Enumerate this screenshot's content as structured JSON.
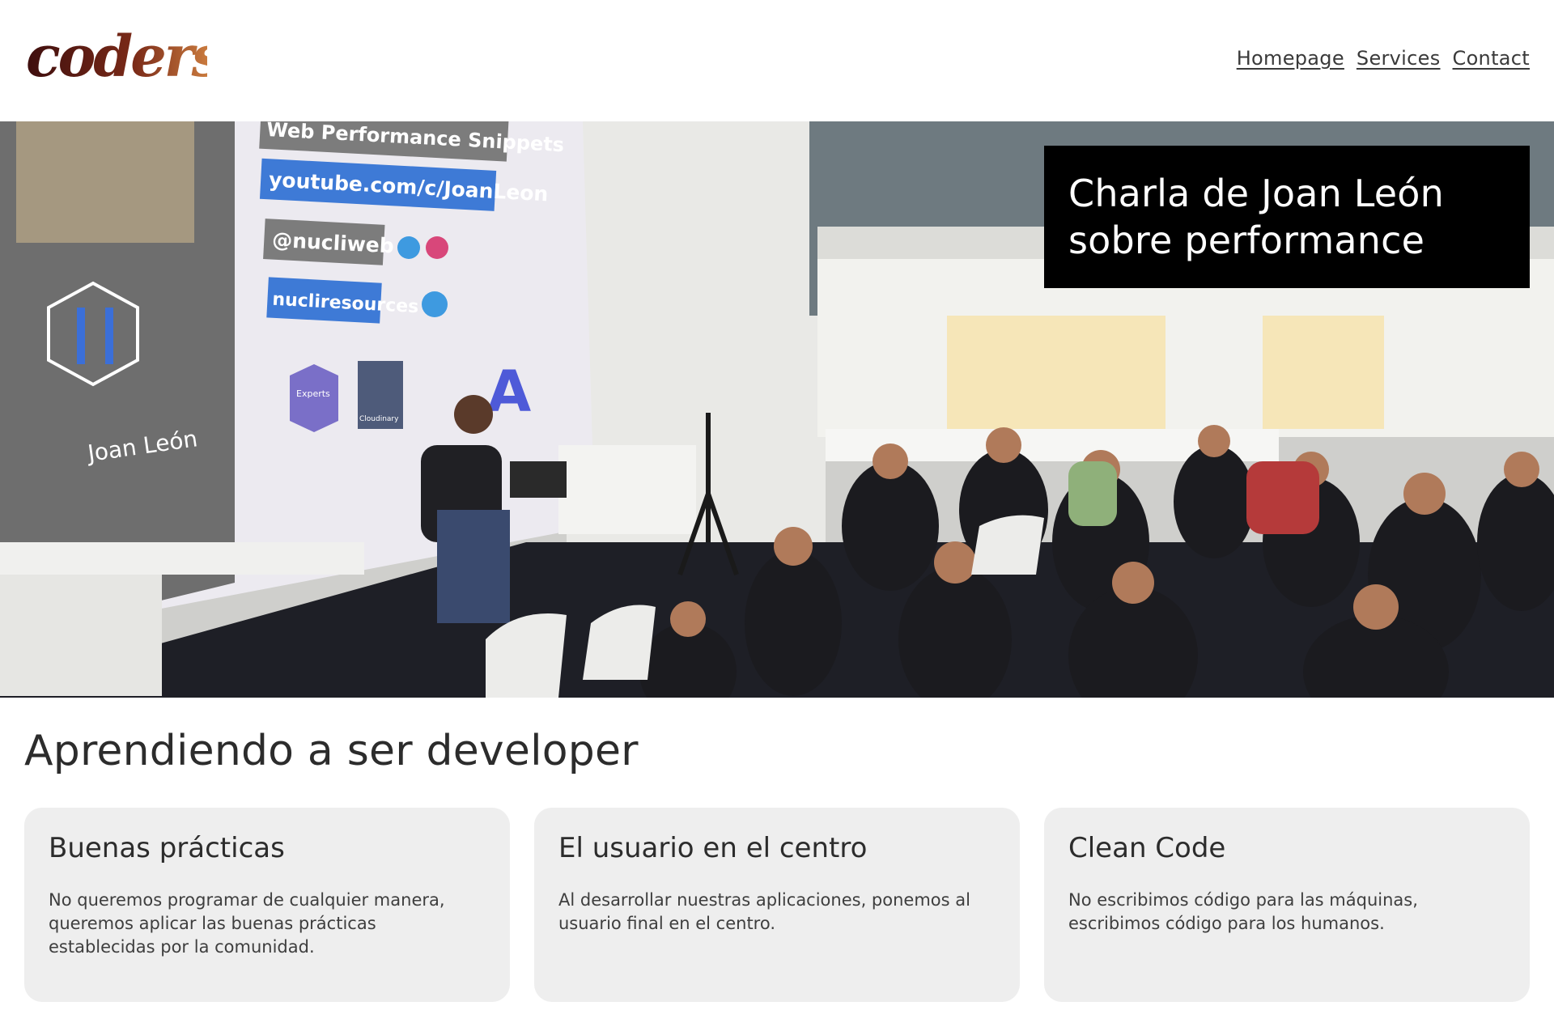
{
  "header": {
    "logo_text": "coders",
    "nav": [
      {
        "label": "Homepage"
      },
      {
        "label": "Services"
      },
      {
        "label": "Contact"
      }
    ]
  },
  "hero": {
    "caption": "Charla de Joan León sobre performance",
    "slide": {
      "title": "Web Performance Snippets",
      "youtube": "youtube.com/c/JoanLeon",
      "handle": "@nucliweb",
      "resources": "nucliresources",
      "speaker": "Joan León",
      "badge_experts": "Experts",
      "badge_cloudinary": "Cloudinary"
    }
  },
  "section": {
    "title": "Aprendiendo a ser developer",
    "cards": [
      {
        "title": "Buenas prácticas",
        "text": "No queremos programar de cualquier manera, queremos aplicar las buenas prácticas establecidas por la comunidad."
      },
      {
        "title": "El usuario en el centro",
        "text": "Al desarrollar nuestras aplicaciones, ponemos al usuario final en el centro."
      },
      {
        "title": "Clean Code",
        "text": "No escribimos código para las máquinas, escribimos código para los humanos."
      }
    ]
  },
  "colors": {
    "logo_dark": "#4a1412",
    "logo_light": "#d07a3a",
    "caption_bg": "#000000",
    "card_bg": "#eeeeee"
  }
}
